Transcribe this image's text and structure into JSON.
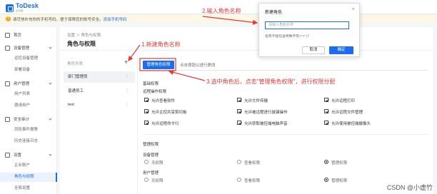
{
  "app": {
    "logo_text": "ToDesk",
    "logo_sub": "企业版"
  },
  "notice": {
    "text": "请尽快补充你的手机号码，便于保障您的账号安全。",
    "link": "添加手机号码"
  },
  "sidebar": {
    "items": [
      {
        "label": "首页"
      },
      {
        "label": "设备管理",
        "subs": [
          "远控设备管理",
          "部署设备"
        ]
      },
      {
        "label": "用户管理",
        "subs": [
          "用户列表",
          "邀请用户"
        ]
      },
      {
        "label": "安全审计",
        "subs": [
          "风险事件报警",
          "历史连接日志"
        ]
      },
      {
        "label": "设置",
        "subs": [
          "企业账户",
          "角色与权限",
          "全局设置"
        ]
      }
    ]
  },
  "breadcrumb": {
    "text": "设置 ＞ 角色与权限"
  },
  "page_title": "角色与权限",
  "roles": {
    "header": "角色列表",
    "add_symbol": "+",
    "items": [
      {
        "label": "部门管理员",
        "more": "⋮"
      },
      {
        "label": "普通员工",
        "more": "⋮"
      },
      {
        "label": "test",
        "more": "⋮"
      }
    ]
  },
  "tabs": {
    "active": "管理角色权限",
    "other": "点击按钮以进行更改"
  },
  "permissions": {
    "section1": "基础权限",
    "group": "远程操作权限",
    "items": [
      "允许查看软件",
      "允许文件传输",
      "允许远程打印",
      "允许主控共享剪切板",
      "允许被远程进行鼠键操作",
      "允许远程文件管理",
      "允许远程命令行",
      "允许获取被控端电脑声音",
      "允许使用被控端摄像头"
    ],
    "section2": "管理权限",
    "device_mgmt": "设备管理",
    "user_mgmt": "用户管理",
    "radio_options": [
      "无权限",
      "查看权限",
      "管理权限"
    ]
  },
  "dialog": {
    "title": "新建角色",
    "close": "×",
    "placeholder": "请输入角色名称",
    "hint": "名称不能包含特殊字符<\">\" |？",
    "cancel": "取消",
    "ok": "确定"
  },
  "annotations": {
    "a1": "1.新建角色名称",
    "a2": "2.输入角色名称",
    "a3": "3.选中角色后，点击\"管理角色权限\"，进行权限分配"
  },
  "watermark": "CSDN @小虚竹",
  "colors": {
    "accent": "#1a6cf0",
    "annotation": "#e53935"
  }
}
